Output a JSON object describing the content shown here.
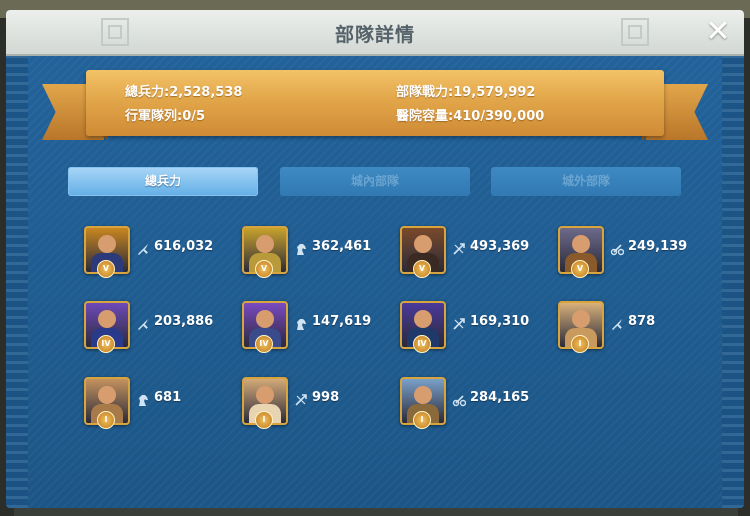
{
  "window": {
    "title": "部隊詳情",
    "close_icon": "close-icon"
  },
  "summary": {
    "total_troops_label": "總兵力:",
    "total_troops_value": "2,528,538",
    "power_label": "部隊戰力:",
    "power_value": "19,579,992",
    "march_label": "行軍隊列:",
    "march_value": "0/5",
    "hospital_label": "醫院容量:",
    "hospital_value": "410/390,000"
  },
  "tabs": [
    {
      "label": "總兵力",
      "active": true
    },
    {
      "label": "城內部隊",
      "active": false
    },
    {
      "label": "城外部隊",
      "active": false
    }
  ],
  "troops": [
    {
      "tier": "V",
      "type": "infantry",
      "count": "616,032",
      "color": "#c8861f",
      "body": "#2d3a7a"
    },
    {
      "tier": "V",
      "type": "cavalry",
      "count": "362,461",
      "color": "#c8a22c",
      "body": "#b99a3a"
    },
    {
      "tier": "V",
      "type": "archer",
      "count": "493,369",
      "color": "#7a4a2a",
      "body": "#3b2a22"
    },
    {
      "tier": "V",
      "type": "siege",
      "count": "249,139",
      "color": "#6d6a8a",
      "body": "#8a5a2a"
    },
    {
      "tier": "IV",
      "type": "infantry",
      "count": "203,886",
      "color": "#6d4ab8",
      "body": "#2a3a8a"
    },
    {
      "tier": "IV",
      "type": "cavalry",
      "count": "147,619",
      "color": "#7a4ac2",
      "body": "#3a4a8a"
    },
    {
      "tier": "IV",
      "type": "archer",
      "count": "169,310",
      "color": "#4a3a9a",
      "body": "#1f3a6a"
    },
    {
      "tier": "I",
      "type": "infantry",
      "count": "878",
      "color": "#d8b07a",
      "body": "#c89a5e"
    },
    {
      "tier": "I",
      "type": "cavalry",
      "count": "681",
      "color": "#c4925e",
      "body": "#a87a4a"
    },
    {
      "tier": "I",
      "type": "archer",
      "count": "998",
      "color": "#d4aa78",
      "body": "#e8d4b0"
    },
    {
      "tier": "I",
      "type": "siege",
      "count": "284,165",
      "color": "#7aa0c8",
      "body": "#8a6a3a"
    }
  ],
  "colors": {
    "panel_blue": "#1f5a8a",
    "banner_gold": "#e2a64a",
    "tab_active": "#62aee6",
    "tab_inactive": "#3079b3",
    "frame_gold": "#d8a43e"
  }
}
